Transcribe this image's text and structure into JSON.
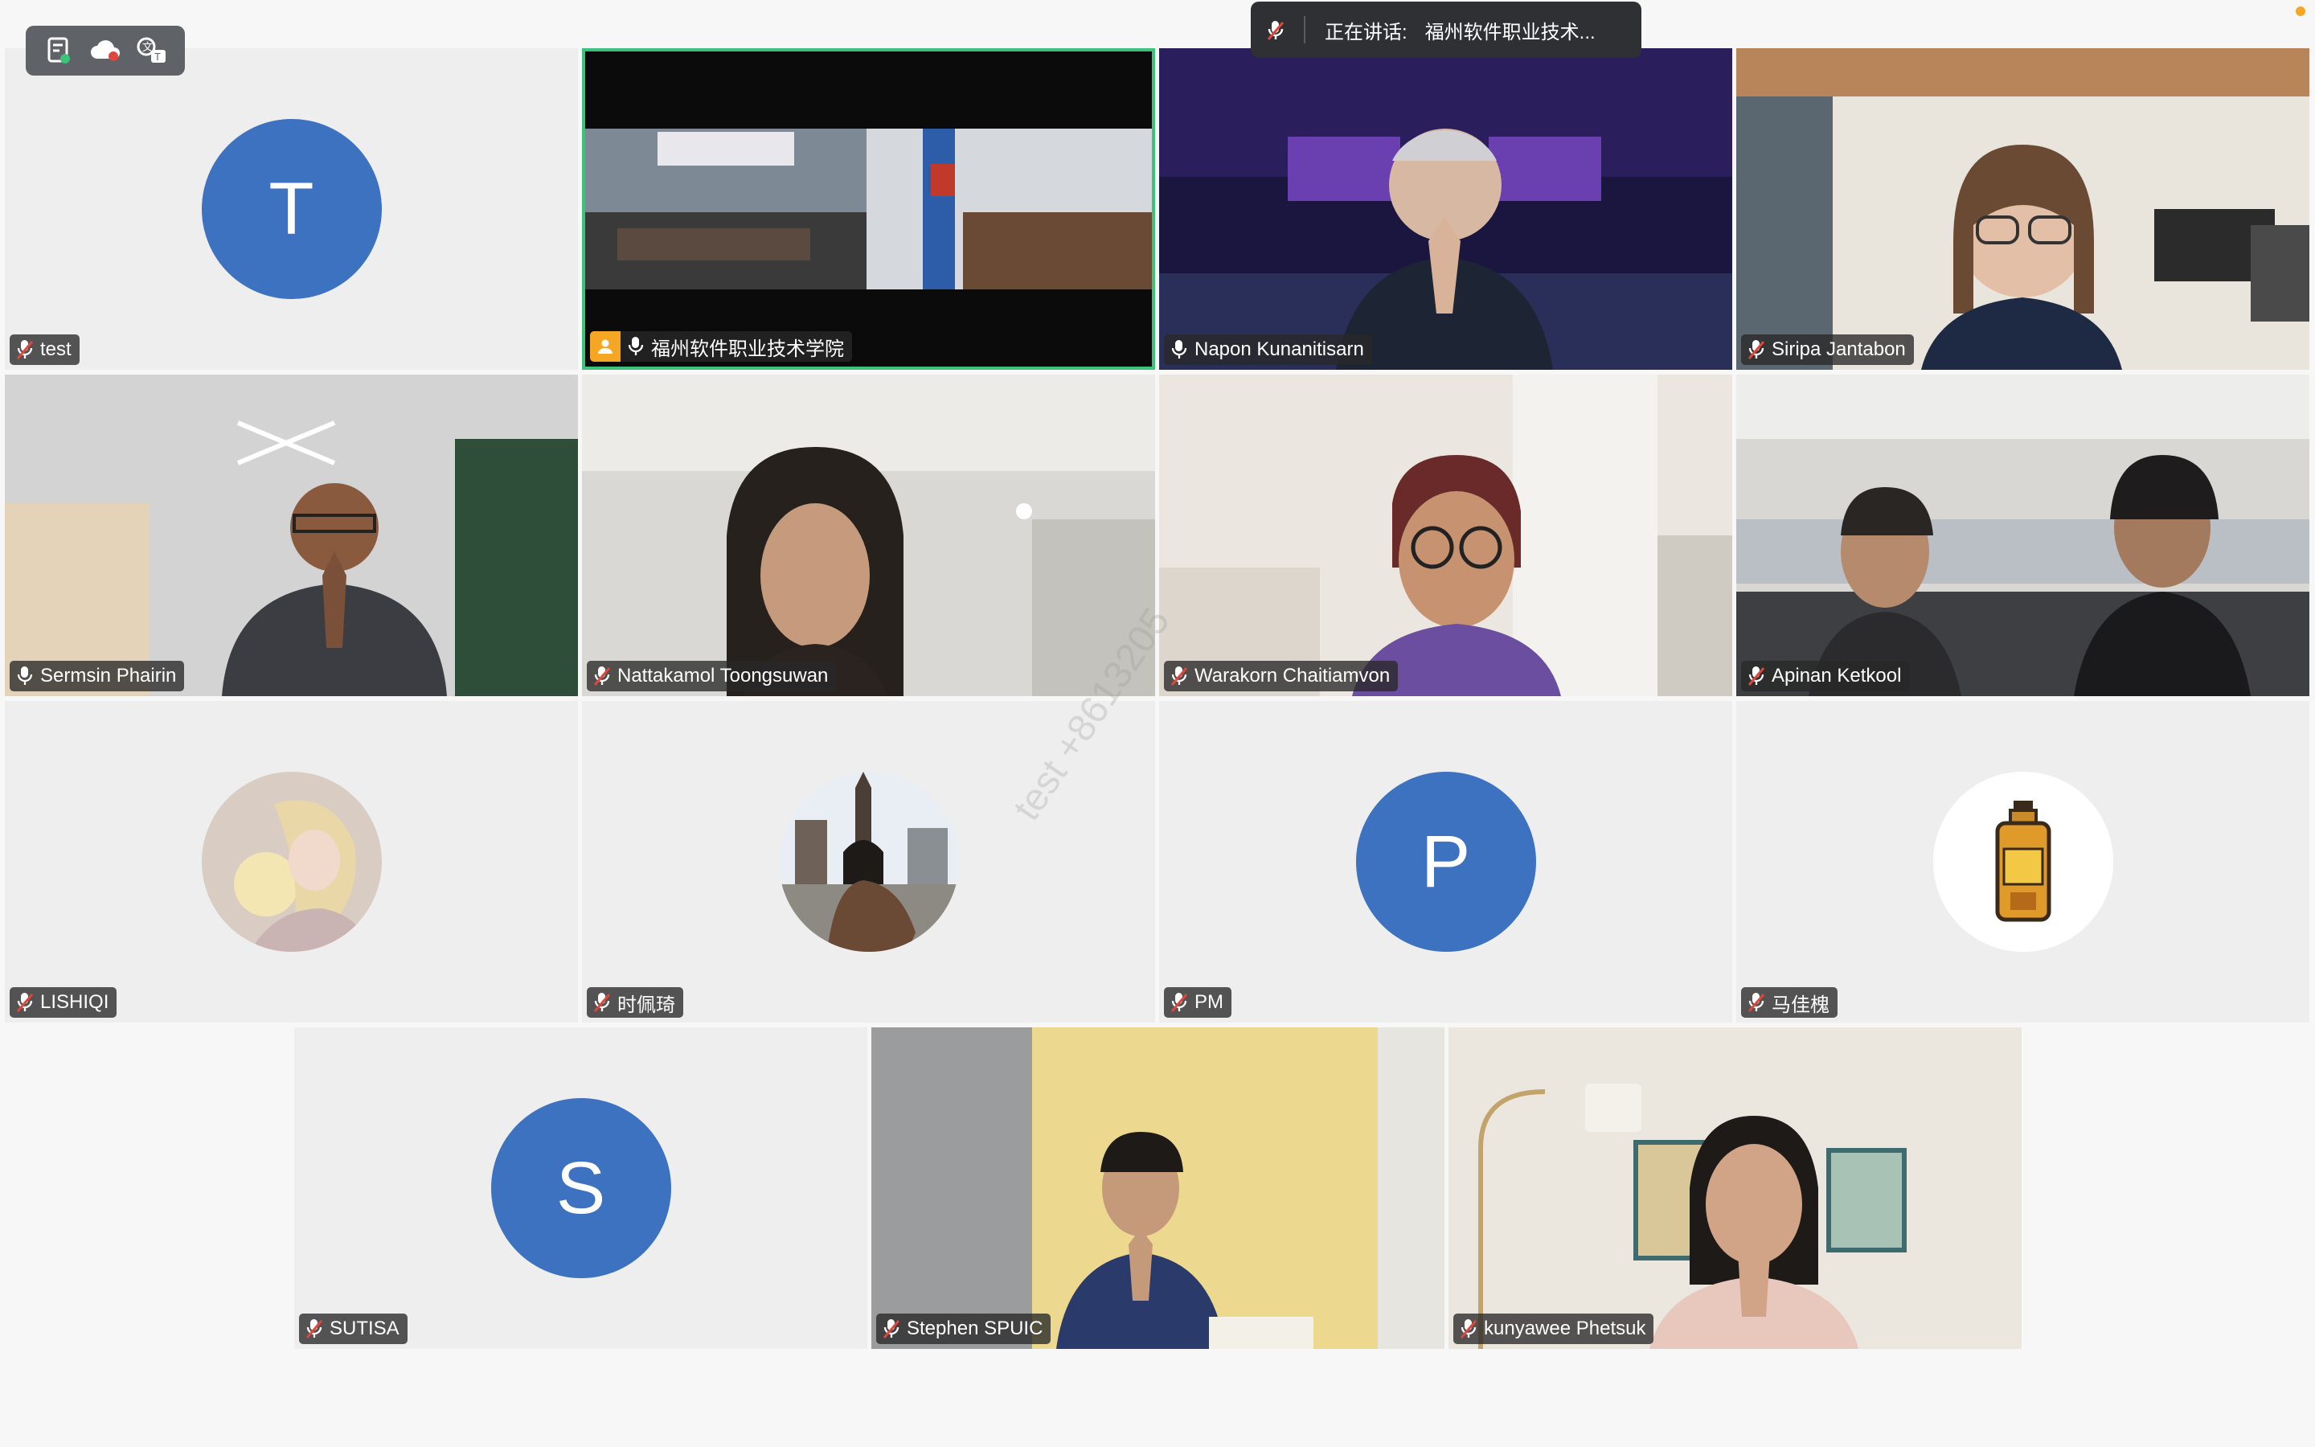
{
  "toolbar": {
    "icons": [
      "document-icon",
      "cloud-record-icon",
      "translate-icon"
    ]
  },
  "speaking": {
    "label": "正在讲话:",
    "name": "福州软件职业技术..."
  },
  "watermark": "test +8613205",
  "participants": [
    {
      "name": "test",
      "initial": "T",
      "muted": true
    },
    {
      "name": "福州软件职业技术学院",
      "muted": false,
      "host": true,
      "active": true
    },
    {
      "name": "Napon Kunanitisarn",
      "muted": false
    },
    {
      "name": "Siripa Jantabon",
      "muted": true
    },
    {
      "name": "Sermsin Phairin",
      "muted": false
    },
    {
      "name": "Nattakamol Toongsuwan",
      "muted": true
    },
    {
      "name": "Warakorn Chaitiamvon",
      "muted": true
    },
    {
      "name": "Apinan Ketkool",
      "muted": true
    },
    {
      "name": "LISHIQI",
      "muted": true
    },
    {
      "name": "时佩琦",
      "muted": true
    },
    {
      "name": "PM",
      "initial": "P",
      "muted": true
    },
    {
      "name": "马佳槐",
      "muted": true
    },
    {
      "name": "SUTISA",
      "initial": "S",
      "muted": true
    },
    {
      "name": "Stephen SPUIC",
      "muted": true
    },
    {
      "name": "kunyawee Phetsuk",
      "muted": true
    }
  ],
  "colors": {
    "avatar_blue": "#3d72c0",
    "active_border": "#3cc27a",
    "host_badge": "#f5a623",
    "muted_red": "#e0463c"
  }
}
